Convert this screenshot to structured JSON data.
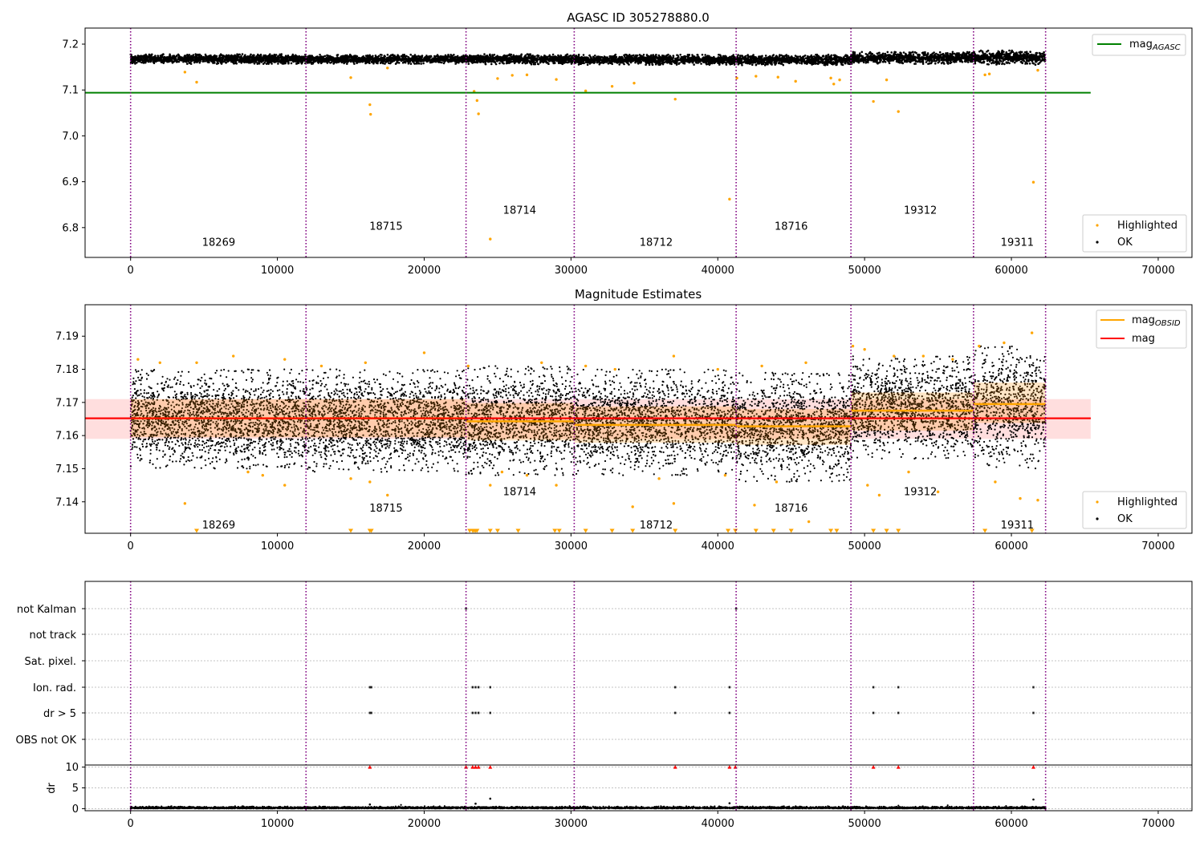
{
  "chart_data": [
    {
      "type": "scatter",
      "title": "AGASC ID 305278880.0",
      "xlim": [
        -3100,
        72300
      ],
      "ylim": [
        6.735,
        7.235
      ],
      "x_ticks": [
        0,
        10000,
        20000,
        30000,
        40000,
        50000,
        60000,
        70000
      ],
      "y_ticks": [
        6.8,
        6.9,
        7.0,
        7.1,
        7.2
      ],
      "obsid_boundaries": [
        0,
        11950,
        22850,
        30220,
        41250,
        49070,
        57420,
        62330
      ],
      "obsid_labels": [
        {
          "text": "18269",
          "x": 6000,
          "y": 6.76
        },
        {
          "text": "18715",
          "x": 17400,
          "y": 6.795
        },
        {
          "text": "18714",
          "x": 26500,
          "y": 6.83
        },
        {
          "text": "18712",
          "x": 35800,
          "y": 6.76
        },
        {
          "text": "18716",
          "x": 45000,
          "y": 6.795
        },
        {
          "text": "19312",
          "x": 53800,
          "y": 6.83
        },
        {
          "text": "19311",
          "x": 60400,
          "y": 6.76
        }
      ],
      "series": [
        {
          "name": "mag_AGASC",
          "kind": "hline",
          "y": 7.094,
          "x": [
            -3100,
            65400
          ],
          "color": "#008000"
        },
        {
          "name": "OK",
          "kind": "dense_band",
          "color": "#000000",
          "segments": [
            {
              "x": [
                0,
                11950
              ],
              "y": [
                7.157,
                7.178
              ]
            },
            {
              "x": [
                11950,
                22850
              ],
              "y": [
                7.157,
                7.177
              ]
            },
            {
              "x": [
                22850,
                30220
              ],
              "y": [
                7.156,
                7.178
              ]
            },
            {
              "x": [
                30220,
                41250
              ],
              "y": [
                7.155,
                7.177
              ]
            },
            {
              "x": [
                41250,
                49070
              ],
              "y": [
                7.154,
                7.177
              ]
            },
            {
              "x": [
                49070,
                57420
              ],
              "y": [
                7.157,
                7.183
              ]
            },
            {
              "x": [
                57420,
                62330
              ],
              "y": [
                7.155,
                7.186
              ]
            }
          ]
        },
        {
          "name": "Highlighted",
          "kind": "points",
          "color": "#ffa500",
          "points": [
            [
              4500,
              7.117
            ],
            [
              3700,
              7.139
            ],
            [
              16300,
              7.068
            ],
            [
              16350,
              7.047
            ],
            [
              15000,
              7.127
            ],
            [
              17500,
              7.148
            ],
            [
              23400,
              7.097
            ],
            [
              23600,
              7.077
            ],
            [
              23700,
              7.048
            ],
            [
              24500,
              6.775
            ],
            [
              25000,
              7.125
            ],
            [
              26000,
              7.132
            ],
            [
              27000,
              7.133
            ],
            [
              29000,
              7.123
            ],
            [
              31000,
              7.098
            ],
            [
              32800,
              7.108
            ],
            [
              34300,
              7.115
            ],
            [
              37100,
              7.08
            ],
            [
              40800,
              6.862
            ],
            [
              41300,
              7.126
            ],
            [
              42600,
              7.13
            ],
            [
              44100,
              7.128
            ],
            [
              45300,
              7.119
            ],
            [
              47700,
              7.126
            ],
            [
              47900,
              7.113
            ],
            [
              48300,
              7.122
            ],
            [
              50600,
              7.075
            ],
            [
              51500,
              7.122
            ],
            [
              52300,
              7.053
            ],
            [
              58200,
              7.133
            ],
            [
              58500,
              7.135
            ],
            [
              61500,
              6.899
            ],
            [
              61800,
              7.143
            ]
          ]
        }
      ],
      "legend": {
        "entries": [
          {
            "label": "mag",
            "subscript": "AGASC"
          }
        ],
        "placement": "top-right"
      },
      "legend2": {
        "entries": [
          "Highlighted",
          "OK"
        ],
        "placement": "lower-right"
      }
    },
    {
      "type": "scatter",
      "title": "Magnitude Estimates",
      "xlim": [
        -3100,
        72300
      ],
      "ylim": [
        7.1305,
        7.1995
      ],
      "x_ticks": [
        0,
        10000,
        20000,
        30000,
        40000,
        50000,
        60000,
        70000
      ],
      "y_ticks": [
        7.14,
        7.15,
        7.16,
        7.17,
        7.18,
        7.19
      ],
      "obsid_boundaries": [
        0,
        11950,
        22850,
        30220,
        41250,
        49070,
        57420,
        62330
      ],
      "obsid_labels": [
        {
          "text": "18269",
          "x": 6000,
          "y": 7.132
        },
        {
          "text": "18715",
          "x": 17400,
          "y": 7.137
        },
        {
          "text": "18714",
          "x": 26500,
          "y": 7.142
        },
        {
          "text": "18712",
          "x": 35800,
          "y": 7.132
        },
        {
          "text": "18716",
          "x": 45000,
          "y": 7.137
        },
        {
          "text": "19312",
          "x": 53800,
          "y": 7.142
        },
        {
          "text": "19311",
          "x": 60400,
          "y": 7.132
        }
      ],
      "series": [
        {
          "name": "mag",
          "kind": "hline",
          "y": 7.1652,
          "band": [
            7.159,
            7.171
          ],
          "x": [
            -3100,
            65400
          ],
          "color": "#ff0000"
        },
        {
          "name": "mag_OBSID",
          "kind": "steps",
          "color": "#ffa500",
          "segments": [
            {
              "x": [
                0,
                22850
              ],
              "y": 7.1652,
              "band": [
                7.1595,
                7.171
              ]
            },
            {
              "x": [
                22850,
                30220
              ],
              "y": 7.1643,
              "band": [
                7.1585,
                7.1698
              ]
            },
            {
              "x": [
                30220,
                41250
              ],
              "y": 7.1632,
              "band": [
                7.1578,
                7.1688
              ]
            },
            {
              "x": [
                41250,
                49070
              ],
              "y": 7.1628,
              "band": [
                7.1572,
                7.168
              ]
            },
            {
              "x": [
                49070,
                57420
              ],
              "y": 7.1675,
              "band": [
                7.1615,
                7.173
              ]
            },
            {
              "x": [
                57420,
                62330
              ],
              "y": 7.1695,
              "band": [
                7.1638,
                7.176
              ]
            }
          ]
        },
        {
          "name": "OK",
          "kind": "dense_band",
          "color": "#000000",
          "segments": [
            {
              "x": [
                0,
                11950
              ],
              "y": [
                7.15,
                7.18
              ]
            },
            {
              "x": [
                11950,
                22850
              ],
              "y": [
                7.149,
                7.18
              ]
            },
            {
              "x": [
                22850,
                30220
              ],
              "y": [
                7.148,
                7.181
              ]
            },
            {
              "x": [
                30220,
                41250
              ],
              "y": [
                7.148,
                7.18
              ]
            },
            {
              "x": [
                41250,
                49070
              ],
              "y": [
                7.146,
                7.179
              ]
            },
            {
              "x": [
                49070,
                57420
              ],
              "y": [
                7.153,
                7.184
              ]
            },
            {
              "x": [
                57420,
                62330
              ],
              "y": [
                7.15,
                7.187
              ]
            }
          ]
        },
        {
          "name": "Highlighted",
          "kind": "points",
          "color": "#ffa500",
          "points": [
            [
              3700,
              7.1395
            ],
            [
              10500,
              7.145
            ],
            [
              8000,
              7.149
            ],
            [
              9000,
              7.148
            ],
            [
              15000,
              7.147
            ],
            [
              16300,
              7.146
            ],
            [
              17500,
              7.142
            ],
            [
              24500,
              7.145
            ],
            [
              25300,
              7.149
            ],
            [
              27000,
              7.148
            ],
            [
              29000,
              7.145
            ],
            [
              34200,
              7.1385
            ],
            [
              36000,
              7.147
            ],
            [
              37000,
              7.1395
            ],
            [
              40500,
              7.148
            ],
            [
              42500,
              7.139
            ],
            [
              44000,
              7.146
            ],
            [
              46200,
              7.134
            ],
            [
              50200,
              7.145
            ],
            [
              51000,
              7.142
            ],
            [
              53000,
              7.149
            ],
            [
              55000,
              7.143
            ],
            [
              58900,
              7.146
            ],
            [
              60600,
              7.141
            ],
            [
              61800,
              7.1405
            ],
            [
              500,
              7.183
            ],
            [
              2000,
              7.182
            ],
            [
              4500,
              7.182
            ],
            [
              7000,
              7.184
            ],
            [
              10500,
              7.183
            ],
            [
              13000,
              7.181
            ],
            [
              16000,
              7.182
            ],
            [
              20000,
              7.185
            ],
            [
              23000,
              7.181
            ],
            [
              28000,
              7.182
            ],
            [
              31000,
              7.181
            ],
            [
              33000,
              7.18
            ],
            [
              37000,
              7.184
            ],
            [
              40000,
              7.18
            ],
            [
              43000,
              7.181
            ],
            [
              46000,
              7.182
            ],
            [
              49200,
              7.187
            ],
            [
              50000,
              7.186
            ],
            [
              52000,
              7.184
            ],
            [
              54000,
              7.184
            ],
            [
              56000,
              7.183
            ],
            [
              57800,
              7.187
            ],
            [
              59500,
              7.188
            ],
            [
              61400,
              7.191
            ]
          ],
          "clipped_below_at_x": [
            4500,
            15000,
            16300,
            16400,
            23100,
            23300,
            23400,
            23500,
            23600,
            24500,
            25000,
            26400,
            28900,
            29200,
            31000,
            32800,
            34200,
            37100,
            40700,
            41200,
            42600,
            43800,
            45000,
            47700,
            48100,
            50600,
            51500,
            52300,
            58200,
            61400
          ]
        }
      ],
      "legend": {
        "entries": [
          {
            "label": "mag",
            "subscript": "OBSID"
          },
          {
            "label": "mag",
            "subscript": ""
          }
        ],
        "placement": "top-right"
      },
      "legend2": {
        "entries": [
          "Highlighted",
          "OK"
        ],
        "placement": "lower-right"
      }
    },
    {
      "type": "scatter",
      "title": "",
      "xlim": [
        -3100,
        72300
      ],
      "x_ticks": [
        0,
        10000,
        20000,
        30000,
        40000,
        50000,
        60000,
        70000
      ],
      "obsid_boundaries": [
        0,
        11950,
        22850,
        30220,
        41250,
        49070,
        57420,
        62330
      ],
      "flag_rows": [
        "not Kalman",
        "not track",
        "Sat. pixel.",
        "Ion. rad.",
        "dr > 5",
        "OBS not OK"
      ],
      "flags": {
        "not Kalman": [
          22850,
          41250
        ],
        "Ion. rad.": [
          16300,
          16400,
          23300,
          23500,
          23700,
          24500,
          37100,
          40800,
          50600,
          52300,
          61500
        ],
        "dr > 5": [
          16300,
          16400,
          23300,
          23500,
          23700,
          24500,
          37100,
          40800,
          50600,
          52300,
          61500
        ]
      },
      "dr": {
        "ylabel": "dr",
        "ylim": [
          -0.5,
          10.5
        ],
        "y_ticks": [
          0,
          5,
          10
        ],
        "clipped_at_10_x": [
          16300,
          22850,
          23300,
          23500,
          23700,
          24500,
          37100,
          40800,
          41200,
          50600,
          52300,
          61500
        ],
        "outliers": [
          [
            16300,
            1.0
          ],
          [
            23500,
            1.2
          ],
          [
            24500,
            2.4
          ],
          [
            40800,
            1.3
          ],
          [
            61500,
            2.2
          ]
        ],
        "baseline": [
          0,
          0.6
        ]
      }
    }
  ]
}
